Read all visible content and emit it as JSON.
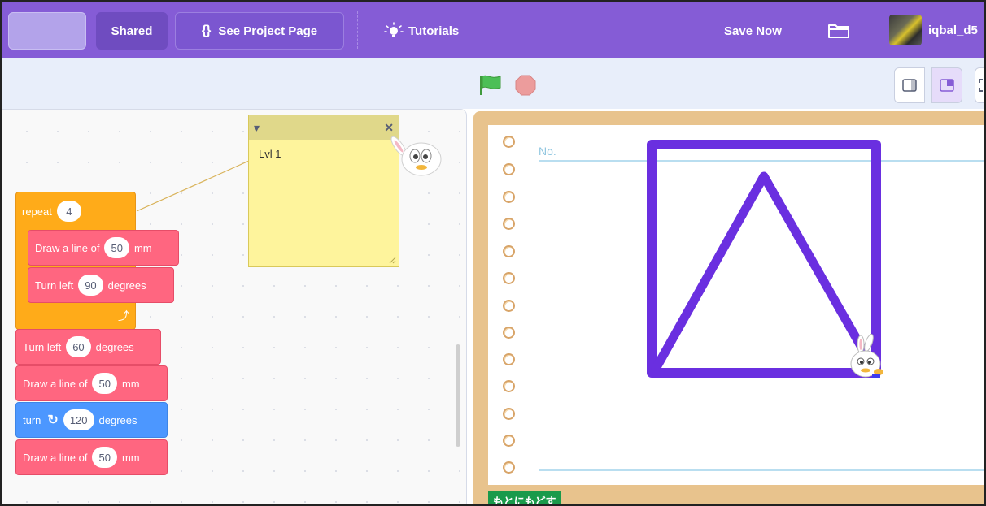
{
  "menubar": {
    "shared_label": "Shared",
    "project_icon": "{}",
    "project_label": "See Project Page",
    "tutorials_label": "Tutorials",
    "save_label": "Save Now",
    "username": "iqbal_d5"
  },
  "comment": {
    "text": "Lvl 1"
  },
  "blocks": {
    "repeat": {
      "label": "repeat",
      "count": "4"
    },
    "draw1": {
      "label": "Draw a line of",
      "value": "50",
      "unit": "mm"
    },
    "turn_left1": {
      "label": "Turn left",
      "value": "90",
      "unit": "degrees"
    },
    "turn_left2": {
      "label": "Turn left",
      "value": "60",
      "unit": "degrees"
    },
    "draw2": {
      "label": "Draw a line of",
      "value": "50",
      "unit": "mm"
    },
    "turn": {
      "label": "turn",
      "icon": "↻",
      "value": "120",
      "unit": "degrees"
    },
    "draw3": {
      "label": "Draw a line of",
      "value": "50",
      "unit": "mm"
    }
  },
  "stage": {
    "no_label": "No.",
    "return_button": "もとにもどす"
  },
  "colors": {
    "menu": "#855cd6",
    "motion_pink": "#ff6680",
    "control_orange": "#ffab19",
    "motion_blue": "#4c97ff",
    "pen": "#6a2fe0"
  }
}
